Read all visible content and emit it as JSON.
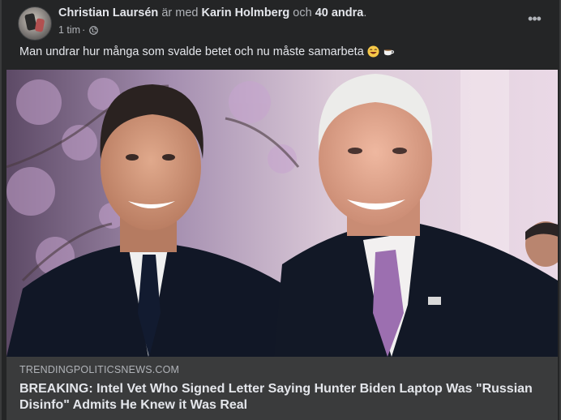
{
  "post": {
    "author": "Christian Laursén",
    "with_text": "är med",
    "tagged": "Karin Holmberg",
    "and_text": "och",
    "others": "40 andra",
    "period": ".",
    "time": "1 tim",
    "dot": "·",
    "privacy_icon": "globe-icon",
    "more_icon": "more-options-icon",
    "text": "Man undrar hur många som svalde betet och nu måste samarbeta",
    "emojis": [
      "laughing-face-emoji",
      "coffee-cup-emoji"
    ]
  },
  "link": {
    "domain": "TRENDINGPOLITICSNEWS.COM",
    "headline": "BREAKING: Intel Vet Who Signed Letter Saying Hunter Biden Laptop Was \"Russian Disinfo\" Admits He Knew it Was Real"
  },
  "colors": {
    "background": "#242526",
    "primary_text": "#e4e6eb",
    "secondary_text": "#b0b3b8",
    "card": "#3a3b3c"
  }
}
